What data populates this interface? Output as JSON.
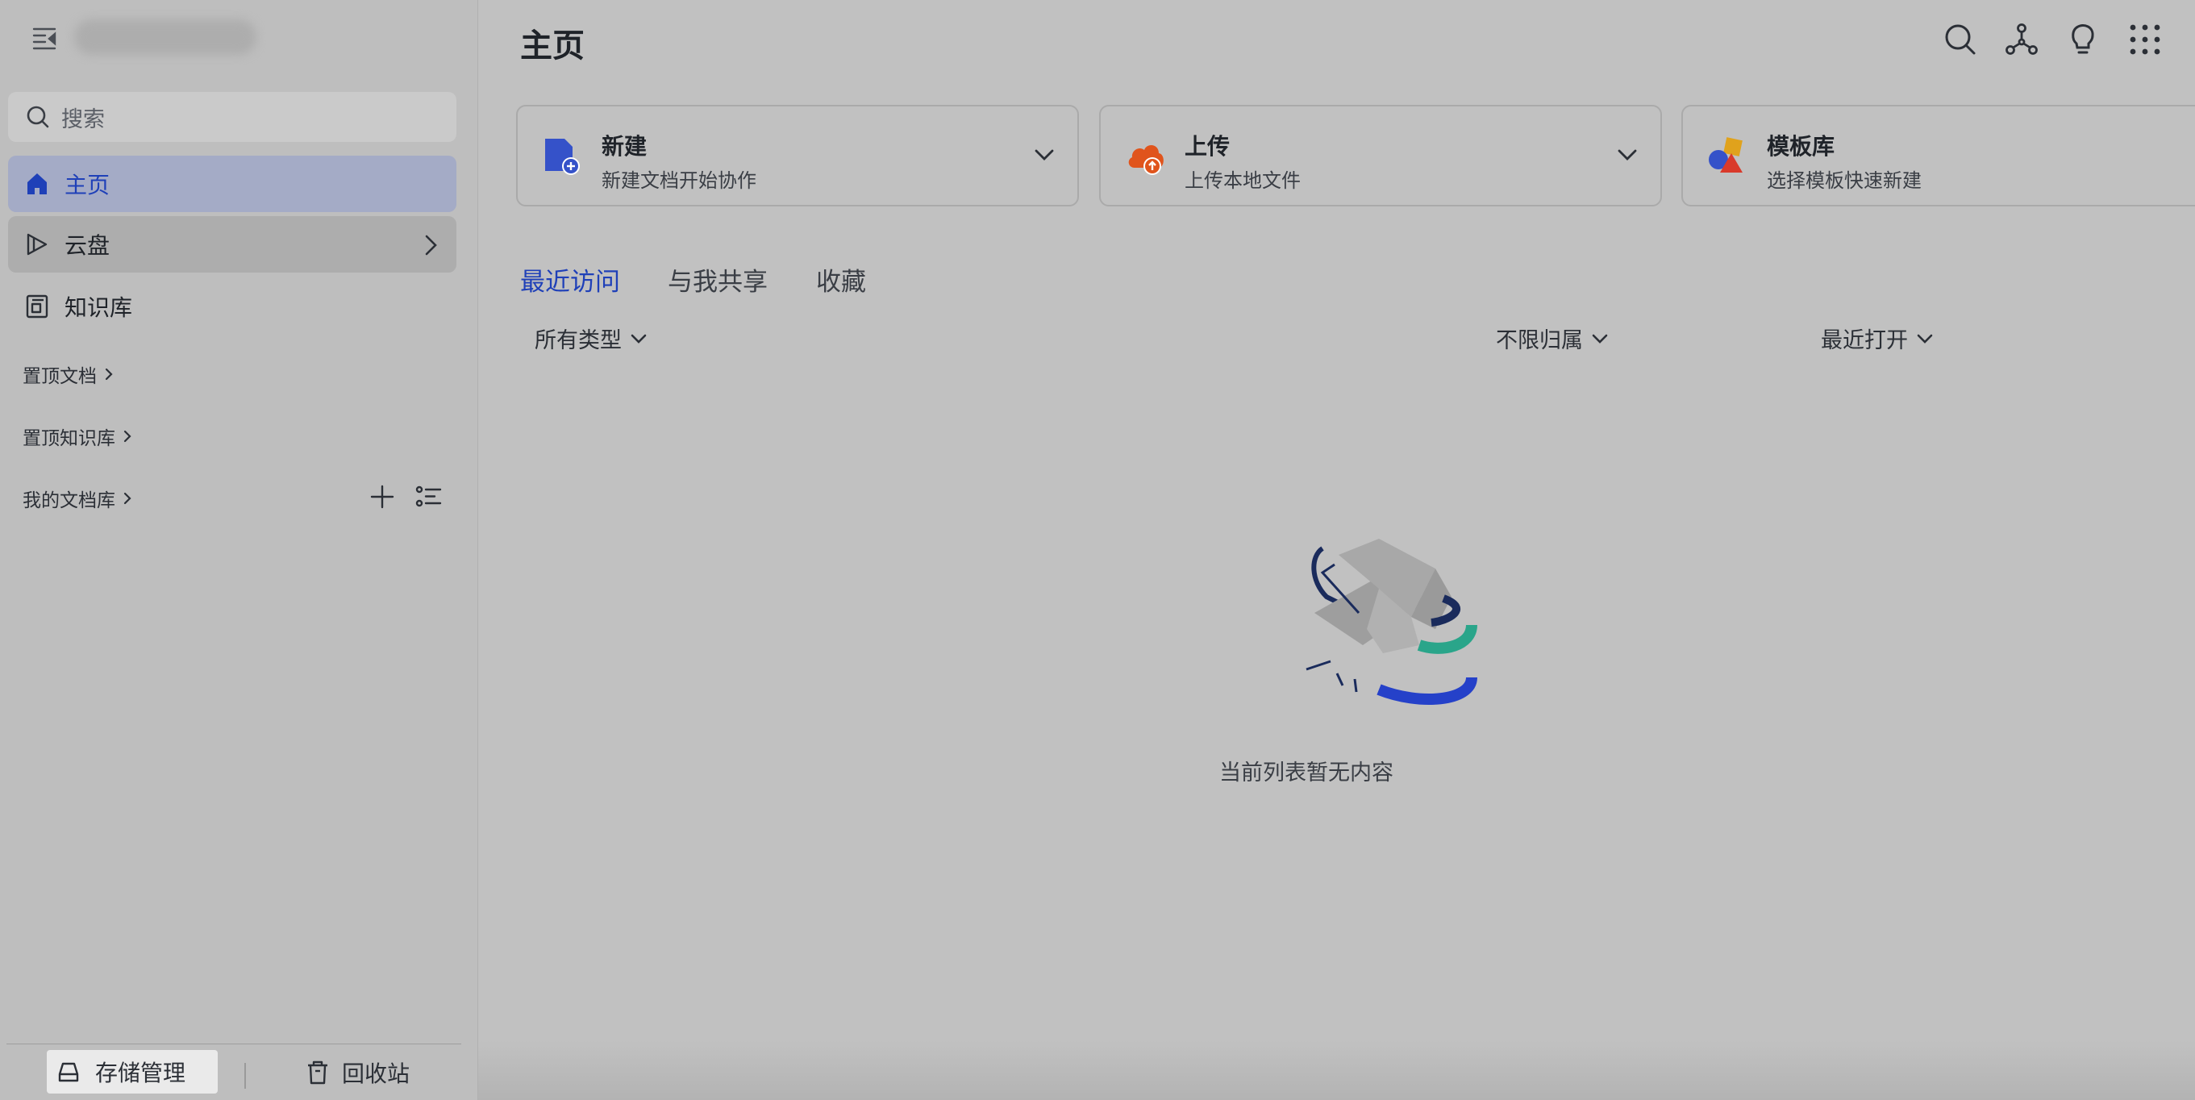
{
  "sidebar": {
    "search_placeholder": "搜索",
    "nav": [
      {
        "label": "主页"
      },
      {
        "label": "云盘"
      },
      {
        "label": "知识库"
      }
    ],
    "sections": [
      {
        "label": "置顶文档"
      },
      {
        "label": "置顶知识库"
      },
      {
        "label": "我的文档库"
      }
    ],
    "footer": {
      "storage_label": "存储管理",
      "trash_label": "回收站"
    }
  },
  "main": {
    "title": "主页",
    "cards": [
      {
        "title": "新建",
        "subtitle": "新建文档开始协作"
      },
      {
        "title": "上传",
        "subtitle": "上传本地文件"
      },
      {
        "title": "模板库",
        "subtitle": "选择模板快速新建"
      }
    ],
    "tabs": [
      {
        "label": "最近访问"
      },
      {
        "label": "与我共享"
      },
      {
        "label": "收藏"
      }
    ],
    "filters": {
      "type": "所有类型",
      "owner": "不限归属",
      "sort": "最近打开"
    },
    "empty_text": "当前列表暂无内容"
  },
  "colors": {
    "accent": "#1f40b8",
    "home_active_bg": "#a4abc6",
    "upload_orange": "#e0541c",
    "teal": "#2aa58a"
  },
  "icons": [
    "collapse-icon",
    "search-icon",
    "home-icon",
    "cloud-drive-icon",
    "knowledge-base-icon",
    "chevron-right-icon",
    "plus-icon",
    "list-icon",
    "storage-icon",
    "trash-icon",
    "network-icon",
    "lightbulb-icon",
    "apps-grid-icon",
    "new-doc-icon",
    "upload-cloud-icon",
    "template-icon",
    "chevron-down-icon"
  ]
}
